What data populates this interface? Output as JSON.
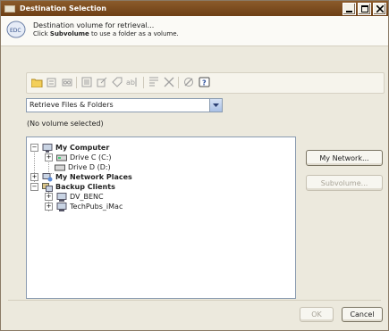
{
  "window": {
    "title": "Destination Selection"
  },
  "header": {
    "line1": "Destination volume for retrieval...",
    "line2_prefix": "Click ",
    "line2_bold": "Subvolume",
    "line2_suffix": " to use a folder as a volume."
  },
  "toolbar": {
    "icons": [
      "new-folder-icon",
      "delete-icon",
      "tape-icon",
      "properties-icon",
      "edit-icon",
      "tag-icon",
      "rename-icon",
      "filter-icon",
      "remove-icon",
      "refresh-icon",
      "help-icon"
    ]
  },
  "retrieve_select": {
    "value": "Retrieve Files & Folders"
  },
  "status": {
    "no_volume": "(No volume selected)"
  },
  "tree": {
    "my_computer": "My Computer",
    "drive_c": "Drive C (C:)",
    "drive_d": "Drive D (D:)",
    "network_places": "My Network Places",
    "backup_clients": "Backup Clients",
    "client1": "DV_BENC",
    "client2": "TechPubs_iMac"
  },
  "buttons": {
    "my_network": "My Network...",
    "subvolume": "Subvolume...",
    "ok": "OK",
    "cancel": "Cancel"
  },
  "colors": {
    "title_bar": "#7a4a1f",
    "dialog_bg": "#ece9dd",
    "field_border": "#8a9bb0"
  }
}
